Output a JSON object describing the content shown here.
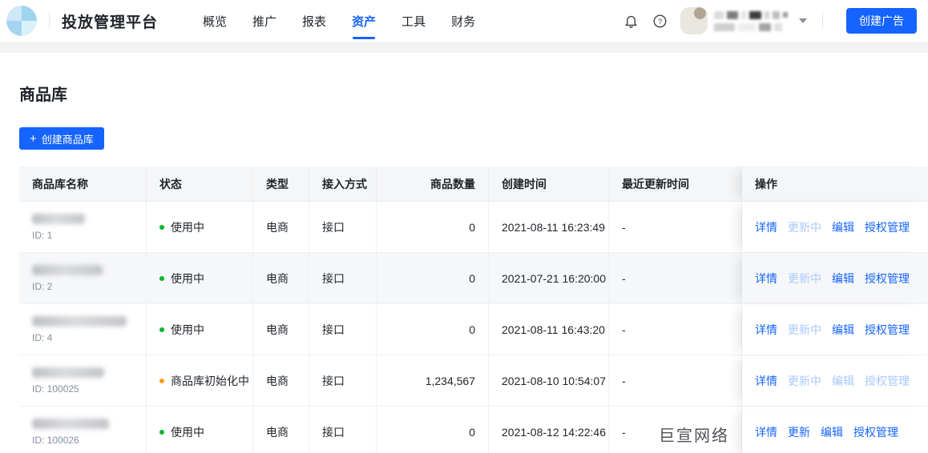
{
  "colors": {
    "accent_blue": "#1664ff",
    "link_disabled": "#a9c8fd",
    "status_green": "#00b42a",
    "status_amber": "#ff9c19",
    "table_header_bg": "#f5f6f7"
  },
  "header": {
    "brand": "投放管理平台",
    "nav": [
      {
        "label": "概览",
        "active": false
      },
      {
        "label": "推广",
        "active": false
      },
      {
        "label": "报表",
        "active": false
      },
      {
        "label": "资产",
        "active": true
      },
      {
        "label": "工具",
        "active": false
      },
      {
        "label": "财务",
        "active": false
      }
    ],
    "icons": [
      "bell-icon",
      "help-icon",
      "caret-down-icon"
    ],
    "create_ad_button": "创建广告"
  },
  "page": {
    "title": "商品库",
    "plus": "+",
    "create_library_button": "创建商品库"
  },
  "table": {
    "columns": [
      "商品库名称",
      "状态",
      "类型",
      "接入方式",
      "商品数量",
      "创建时间",
      "最近更新时间",
      "操作"
    ],
    "rows": [
      {
        "id": "ID: 1",
        "status": "使用中",
        "status_color": "#00b42a",
        "type": "电商",
        "access": "接口",
        "count": "0",
        "created": "2021-08-11 16:23:49",
        "updated": "-",
        "actions": [
          {
            "label": "详情",
            "enabled": true
          },
          {
            "label": "更新中",
            "enabled": false
          },
          {
            "label": "编辑",
            "enabled": true
          },
          {
            "label": "授权管理",
            "enabled": true
          }
        ]
      },
      {
        "id": "ID: 2",
        "status": "使用中",
        "status_color": "#00b42a",
        "type": "电商",
        "access": "接口",
        "count": "0",
        "created": "2021-07-21 16:20:00",
        "updated": "-",
        "actions": [
          {
            "label": "详情",
            "enabled": true
          },
          {
            "label": "更新中",
            "enabled": false
          },
          {
            "label": "编辑",
            "enabled": true
          },
          {
            "label": "授权管理",
            "enabled": true
          }
        ]
      },
      {
        "id": "ID: 4",
        "status": "使用中",
        "status_color": "#00b42a",
        "type": "电商",
        "access": "接口",
        "count": "0",
        "created": "2021-08-11 16:43:20",
        "updated": "-",
        "actions": [
          {
            "label": "详情",
            "enabled": true
          },
          {
            "label": "更新中",
            "enabled": false
          },
          {
            "label": "编辑",
            "enabled": true
          },
          {
            "label": "授权管理",
            "enabled": true
          }
        ]
      },
      {
        "id": "ID: 100025",
        "status": "商品库初始化中",
        "status_color": "#ff9c19",
        "type": "电商",
        "access": "接口",
        "count": "1,234,567",
        "created": "2021-08-10 10:54:07",
        "updated": "-",
        "actions": [
          {
            "label": "详情",
            "enabled": true
          },
          {
            "label": "更新中",
            "enabled": false
          },
          {
            "label": "编辑",
            "enabled": false
          },
          {
            "label": "授权管理",
            "enabled": false
          }
        ]
      },
      {
        "id": "ID: 100026",
        "status": "使用中",
        "status_color": "#00b42a",
        "type": "电商",
        "access": "接口",
        "count": "0",
        "created": "2021-08-12 14:22:46",
        "updated": "-",
        "actions": [
          {
            "label": "详情",
            "enabled": true
          },
          {
            "label": "更新",
            "enabled": true
          },
          {
            "label": "编辑",
            "enabled": true
          },
          {
            "label": "授权管理",
            "enabled": true
          }
        ]
      }
    ]
  },
  "watermark": "巨宣网络"
}
